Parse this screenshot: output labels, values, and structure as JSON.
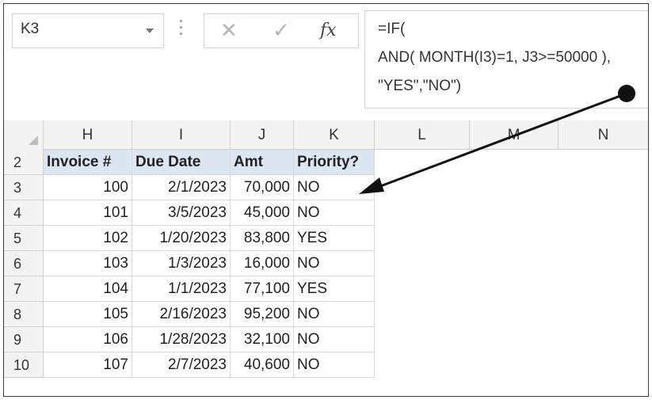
{
  "namebox": {
    "value": "K3"
  },
  "formula_bar": {
    "lines": [
      "=IF(",
      "AND( MONTH(I3)=1, J3>=50000 ),",
      "\"YES\",\"NO\")"
    ]
  },
  "icons": {
    "cancel": "✕",
    "enter": "✓",
    "fx": "fx"
  },
  "columns": [
    "H",
    "I",
    "J",
    "K",
    "L",
    "M",
    "N"
  ],
  "header_row": {
    "number": "2",
    "cells": [
      "Invoice #",
      "Due Date",
      "Amt",
      "Priority?"
    ]
  },
  "rows": [
    {
      "number": "3",
      "cells": [
        "100",
        "2/1/2023",
        "70,000",
        "NO"
      ]
    },
    {
      "number": "4",
      "cells": [
        "101",
        "3/5/2023",
        "45,000",
        "NO"
      ]
    },
    {
      "number": "5",
      "cells": [
        "102",
        "1/20/2023",
        "83,800",
        "YES"
      ]
    },
    {
      "number": "6",
      "cells": [
        "103",
        "1/3/2023",
        "16,000",
        "NO"
      ]
    },
    {
      "number": "7",
      "cells": [
        "104",
        "1/1/2023",
        "77,100",
        "YES"
      ]
    },
    {
      "number": "8",
      "cells": [
        "105",
        "2/16/2023",
        "95,200",
        "NO"
      ]
    },
    {
      "number": "9",
      "cells": [
        "106",
        "1/28/2023",
        "32,100",
        "NO"
      ]
    },
    {
      "number": "10",
      "cells": [
        "107",
        "2/7/2023",
        "40,600",
        "NO"
      ]
    }
  ],
  "colors": {
    "header_fill": "#dce6f2",
    "gridline": "#d9d9d9",
    "annotation": "#111111"
  }
}
